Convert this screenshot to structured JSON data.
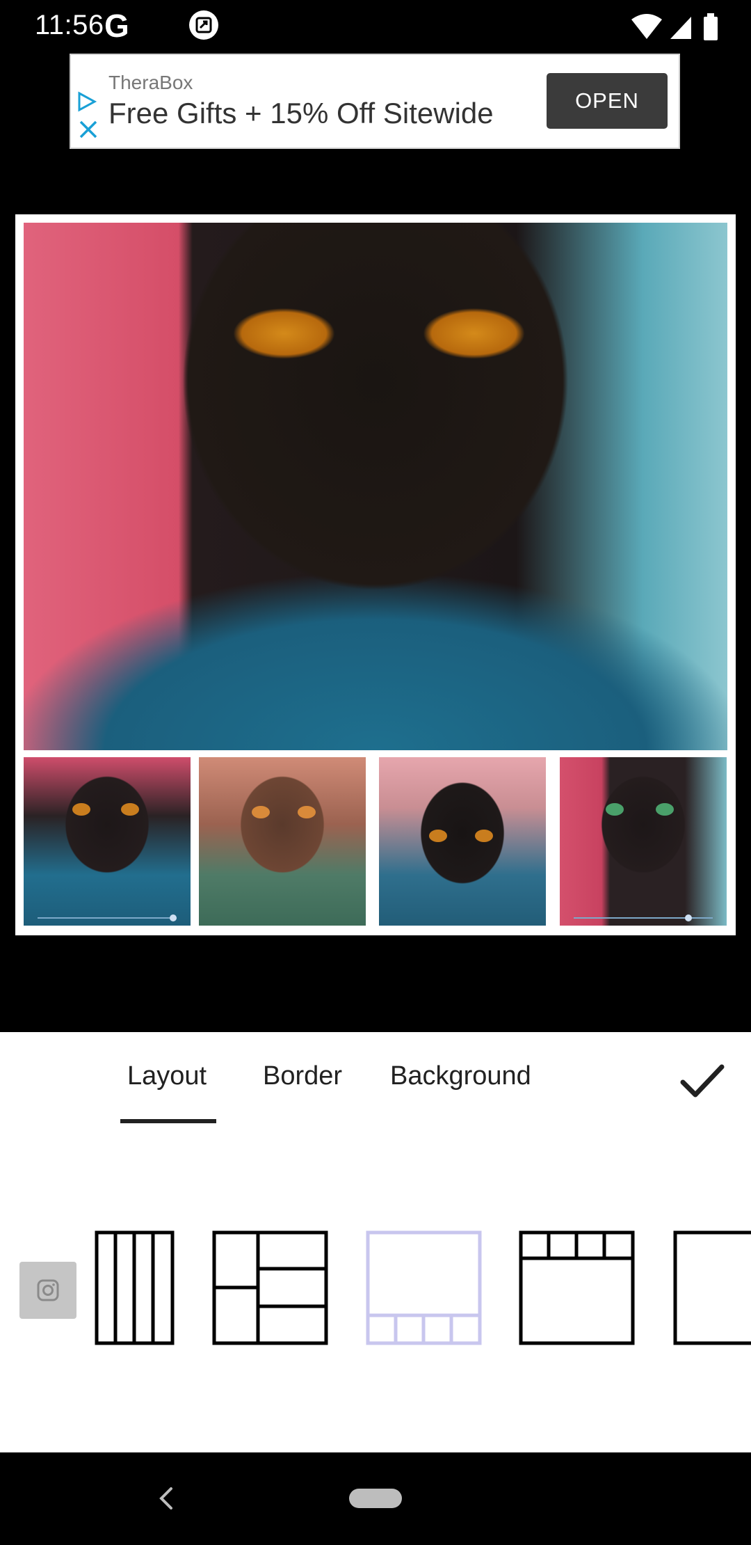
{
  "status_bar": {
    "time": "11:56",
    "g_glyph": "G",
    "icons": [
      "google-g-icon",
      "screenshot-icon",
      "wifi-icon",
      "signal-icon",
      "battery-icon"
    ]
  },
  "ad": {
    "brand": "TheraBox",
    "headline": "Free Gifts + 15% Off Sitewide",
    "cta": "OPEN",
    "icons": [
      "ad-choices-icon",
      "ad-close-icon"
    ]
  },
  "collage": {
    "photos": [
      "photo-main",
      "photo-thumb-1",
      "photo-thumb-2",
      "photo-thumb-3",
      "photo-thumb-4"
    ]
  },
  "editor": {
    "tabs": [
      {
        "label": "Layout",
        "selected": true
      },
      {
        "label": "Border",
        "selected": false
      },
      {
        "label": "Background",
        "selected": false
      }
    ],
    "confirm_icon": "check-icon",
    "instagram_icon": "instagram-icon",
    "layout_options": [
      "four-columns",
      "left-plus-stacked-right",
      "large-top-four-bottom",
      "four-top-large-bottom",
      "single-frame"
    ],
    "selected_layout_index": 2,
    "colors": {
      "selected_layout": "#c8c6ee",
      "layout": "#000000",
      "tab_indicator": "#212121"
    }
  },
  "nav_bar": {
    "icons": [
      "back-icon",
      "home-pill"
    ]
  }
}
